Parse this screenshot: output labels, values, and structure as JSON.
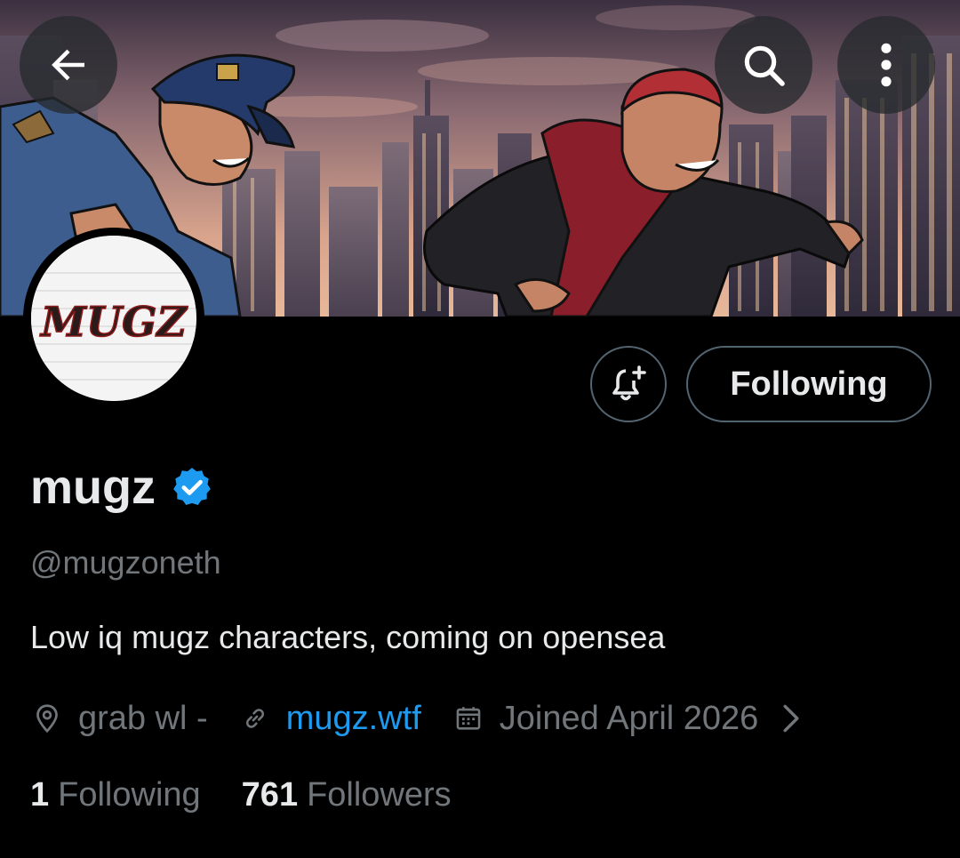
{
  "banner": {
    "image": "cartoon-banner-police-officer-chasing-red-haired-character-city-skyline",
    "sky_top": "#3a2f3f",
    "sky_bottom": "#d8a28a"
  },
  "nav": {
    "back_icon": "arrow-left-icon",
    "search_icon": "search-icon",
    "more_icon": "more-vertical-icon"
  },
  "avatar": {
    "logo_text": "MUGZ"
  },
  "actions": {
    "notify_icon": "bell-plus-icon",
    "following_label": "Following"
  },
  "profile": {
    "display_name": "mugz",
    "verified_color": "#1d9bf0",
    "handle": "@mugzoneth",
    "bio": "Low iq mugz characters, coming on opensea",
    "location": "grab wl -",
    "website": "mugz.wtf",
    "joined": "Joined April 2026"
  },
  "stats": {
    "following_count": "1",
    "following_label": "Following",
    "followers_count": "761",
    "followers_label": "Followers"
  },
  "colors": {
    "background": "#000000",
    "text_primary": "#e7e9ea",
    "text_secondary": "#71767b",
    "link": "#1d9bf0",
    "border": "#536471"
  }
}
